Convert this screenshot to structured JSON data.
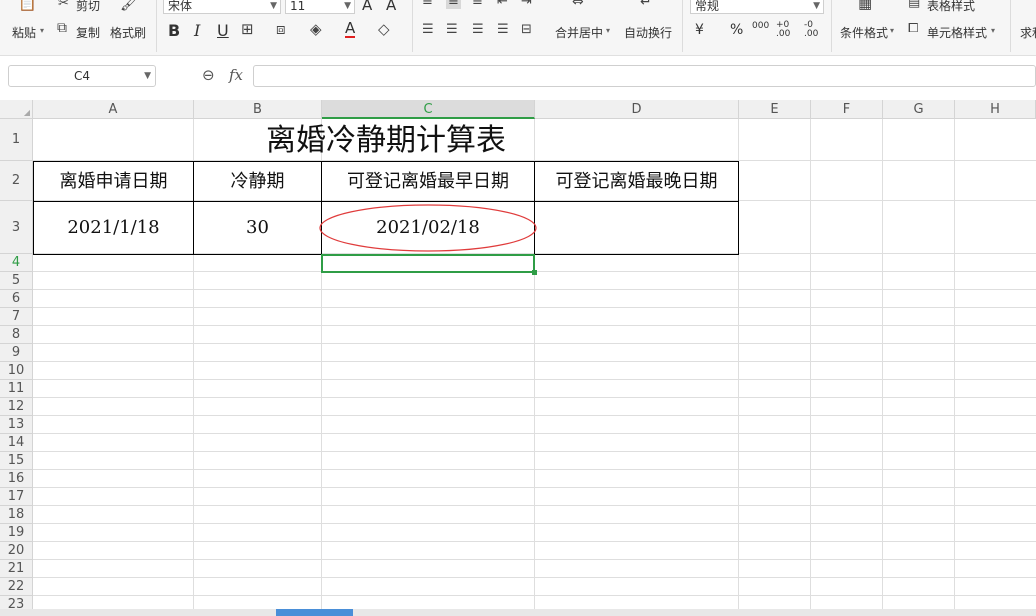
{
  "ribbon": {
    "paste": "粘贴",
    "cut": "剪切",
    "copy": "复制",
    "format_painter": "格式刷",
    "font_name": "宋体",
    "font_size": "11",
    "bold": "B",
    "italic": "I",
    "underline": "U",
    "merge_center": "合并居中",
    "wrap_text": "自动换行",
    "number_format": "常规",
    "currency": "¥",
    "percent": "%",
    "thousands": "000",
    "inc_decimal": "+0 .00",
    "dec_decimal": "-0 .00",
    "conditional_format": "条件格式",
    "table_style": "表格样式",
    "cell_style": "单元格样式",
    "sum": "求和"
  },
  "formula_bar": {
    "name_box": "C4",
    "fx": "fx",
    "value": ""
  },
  "columns": [
    "A",
    "B",
    "C",
    "D",
    "E",
    "F",
    "G",
    "H"
  ],
  "selected_column": "C",
  "rows": [
    "1",
    "2",
    "3",
    "4",
    "5",
    "6",
    "7",
    "8",
    "9",
    "10",
    "11",
    "12",
    "13",
    "14",
    "15",
    "16",
    "17",
    "18",
    "19",
    "20",
    "21",
    "22",
    "23"
  ],
  "selected_row": "4",
  "sheet": {
    "title": "离婚冷静期计算表",
    "headers": [
      "离婚申请日期",
      "冷静期",
      "可登记离婚最早日期",
      "可登记离婚最晚日期"
    ],
    "values": [
      "2021/1/18",
      "30",
      "2021/02/18",
      ""
    ]
  },
  "colors": {
    "accent_green": "#2f9d46",
    "circle_red": "#e03c3c"
  }
}
